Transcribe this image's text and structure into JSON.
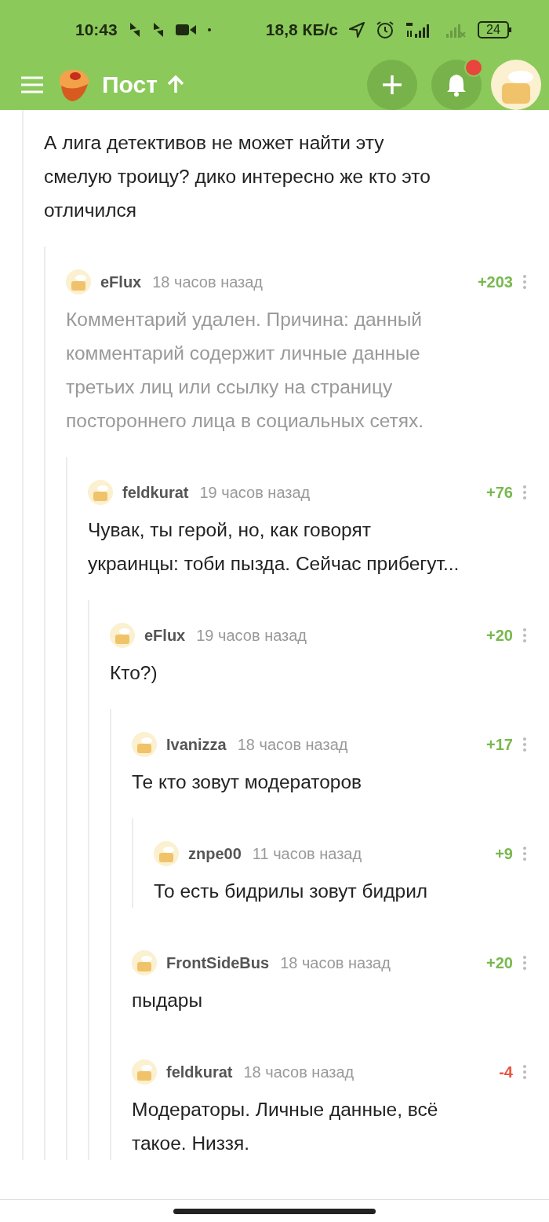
{
  "status_bar": {
    "time": "10:43",
    "speed": "18,8 КБ/с",
    "battery": "24"
  },
  "app_bar": {
    "title": "Пост",
    "notification": true
  },
  "thread": {
    "lines": [
      "А лига детективов не может найти эту",
      "смелую троицу? дико интересно же кто это",
      "отличился"
    ],
    "deleted": false,
    "children": [
      {
        "author": "eFlux",
        "time": "18 часов назад",
        "score": "+203",
        "negative": false,
        "deleted": true,
        "lines": [
          "Комментарий удален. Причина: данный",
          "комментарий содержит личные данные",
          "третьих лиц или ссылку на страницу",
          "постороннего лица в социальных сетях."
        ],
        "children": [
          {
            "author": "feldkurat",
            "time": "19 часов назад",
            "score": "+76",
            "negative": false,
            "deleted": false,
            "lines": [
              "Чувак, ты герой, но, как говорят",
              "украинцы: тоби пызда. Сейчас прибегут..."
            ],
            "children": [
              {
                "author": "eFlux",
                "time": "19 часов назад",
                "score": "+20",
                "negative": false,
                "deleted": false,
                "lines": [
                  "Кто?)"
                ],
                "children": [
                  {
                    "author": "Ivanizza",
                    "time": "18 часов назад",
                    "score": "+17",
                    "negative": false,
                    "deleted": false,
                    "lines": [
                      "Те кто зовут модераторов"
                    ],
                    "children": [
                      {
                        "author": "znpe00",
                        "time": "11 часов назад",
                        "score": "+9",
                        "negative": false,
                        "deleted": false,
                        "lines": [
                          "То есть бидрилы зовут бидрил"
                        ]
                      }
                    ]
                  },
                  {
                    "author": "FrontSideBus",
                    "time": "18 часов назад",
                    "score": "+20",
                    "negative": false,
                    "deleted": false,
                    "lines": [
                      "пыдары"
                    ]
                  },
                  {
                    "author": "feldkurat",
                    "time": "18 часов назад",
                    "score": "-4",
                    "negative": true,
                    "deleted": false,
                    "lines": [
                      "Модераторы. Личные данные, всё",
                      "такое. Низзя."
                    ]
                  }
                ]
              }
            ]
          }
        ]
      }
    ]
  }
}
